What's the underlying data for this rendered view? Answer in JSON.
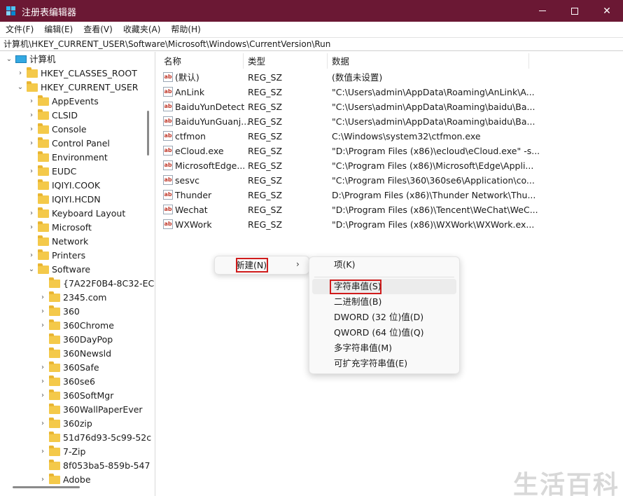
{
  "window": {
    "title": "注册表编辑器",
    "controls": {
      "minimize": "",
      "maximize": "",
      "close": "✕"
    }
  },
  "menu": [
    "文件(F)",
    "编辑(E)",
    "查看(V)",
    "收藏夹(A)",
    "帮助(H)"
  ],
  "address": "计算机\\HKEY_CURRENT_USER\\Software\\Microsoft\\Windows\\CurrentVersion\\Run",
  "tree": [
    {
      "label": "计算机",
      "chev": "⌄",
      "level": 0,
      "icon": "computer-icon"
    },
    {
      "label": "HKEY_CLASSES_ROOT",
      "chev": "›",
      "level": 1,
      "icon": "folder-icon"
    },
    {
      "label": "HKEY_CURRENT_USER",
      "chev": "⌄",
      "level": 1,
      "icon": "folder-icon"
    },
    {
      "label": "AppEvents",
      "chev": "›",
      "level": 2,
      "icon": "folder-icon"
    },
    {
      "label": "CLSID",
      "chev": "›",
      "level": 2,
      "icon": "folder-icon"
    },
    {
      "label": "Console",
      "chev": "›",
      "level": 2,
      "icon": "folder-icon"
    },
    {
      "label": "Control Panel",
      "chev": "›",
      "level": 2,
      "icon": "folder-icon"
    },
    {
      "label": "Environment",
      "chev": "",
      "level": 2,
      "icon": "folder-icon"
    },
    {
      "label": "EUDC",
      "chev": "›",
      "level": 2,
      "icon": "folder-icon"
    },
    {
      "label": "IQIYI.COOK",
      "chev": "",
      "level": 2,
      "icon": "folder-icon"
    },
    {
      "label": "IQIYI.HCDN",
      "chev": "",
      "level": 2,
      "icon": "folder-icon"
    },
    {
      "label": "Keyboard Layout",
      "chev": "›",
      "level": 2,
      "icon": "folder-icon"
    },
    {
      "label": "Microsoft",
      "chev": "›",
      "level": 2,
      "icon": "folder-icon"
    },
    {
      "label": "Network",
      "chev": "",
      "level": 2,
      "icon": "folder-icon"
    },
    {
      "label": "Printers",
      "chev": "›",
      "level": 2,
      "icon": "folder-icon"
    },
    {
      "label": "Software",
      "chev": "⌄",
      "level": 2,
      "icon": "folder-icon"
    },
    {
      "label": "{7A22F0B4-8C32-EC",
      "chev": "",
      "level": 3,
      "icon": "folder-icon"
    },
    {
      "label": "2345.com",
      "chev": "›",
      "level": 3,
      "icon": "folder-icon"
    },
    {
      "label": "360",
      "chev": "›",
      "level": 3,
      "icon": "folder-icon"
    },
    {
      "label": "360Chrome",
      "chev": "›",
      "level": 3,
      "icon": "folder-icon"
    },
    {
      "label": "360DayPop",
      "chev": "",
      "level": 3,
      "icon": "folder-icon"
    },
    {
      "label": "360Newsld",
      "chev": "",
      "level": 3,
      "icon": "folder-icon"
    },
    {
      "label": "360Safe",
      "chev": "›",
      "level": 3,
      "icon": "folder-icon"
    },
    {
      "label": "360se6",
      "chev": "›",
      "level": 3,
      "icon": "folder-icon"
    },
    {
      "label": "360SoftMgr",
      "chev": "›",
      "level": 3,
      "icon": "folder-icon"
    },
    {
      "label": "360WallPaperEver",
      "chev": "",
      "level": 3,
      "icon": "folder-icon"
    },
    {
      "label": "360zip",
      "chev": "›",
      "level": 3,
      "icon": "folder-icon"
    },
    {
      "label": "51d76d93-5c99-52c",
      "chev": "",
      "level": 3,
      "icon": "folder-icon"
    },
    {
      "label": "7-Zip",
      "chev": "›",
      "level": 3,
      "icon": "folder-icon"
    },
    {
      "label": "8f053ba5-859b-547",
      "chev": "",
      "level": 3,
      "icon": "folder-icon"
    },
    {
      "label": "Adobe",
      "chev": "›",
      "level": 3,
      "icon": "folder-icon"
    }
  ],
  "columns": [
    "名称",
    "类型",
    "数据"
  ],
  "values": [
    {
      "name": "(默认)",
      "type": "REG_SZ",
      "data": "(数值未设置)"
    },
    {
      "name": "AnLink",
      "type": "REG_SZ",
      "data": "\"C:\\Users\\admin\\AppData\\Roaming\\AnLink\\A..."
    },
    {
      "name": "BaiduYunDetect",
      "type": "REG_SZ",
      "data": "\"C:\\Users\\admin\\AppData\\Roaming\\baidu\\Ba..."
    },
    {
      "name": "BaiduYunGuanj...",
      "type": "REG_SZ",
      "data": "\"C:\\Users\\admin\\AppData\\Roaming\\baidu\\Ba..."
    },
    {
      "name": "ctfmon",
      "type": "REG_SZ",
      "data": "C:\\Windows\\system32\\ctfmon.exe"
    },
    {
      "name": "eCloud.exe",
      "type": "REG_SZ",
      "data": "\"D:\\Program Files (x86)\\ecloud\\eCloud.exe\" -s..."
    },
    {
      "name": "MicrosoftEdge...",
      "type": "REG_SZ",
      "data": "\"C:\\Program Files (x86)\\Microsoft\\Edge\\Appli..."
    },
    {
      "name": "sesvc",
      "type": "REG_SZ",
      "data": "\"C:\\Program Files\\360\\360se6\\Application\\co..."
    },
    {
      "name": "Thunder",
      "type": "REG_SZ",
      "data": "D:\\Program Files (x86)\\Thunder Network\\Thu..."
    },
    {
      "name": "Wechat",
      "type": "REG_SZ",
      "data": "\"D:\\Program Files (x86)\\Tencent\\WeChat\\WeC..."
    },
    {
      "name": "WXWork",
      "type": "REG_SZ",
      "data": "\"D:\\Program Files (x86)\\WXWork\\WXWork.ex..."
    }
  ],
  "context_menu": {
    "new_label": "新建(N)",
    "submenu_arrow": "›",
    "submenu": [
      "项(K)",
      "字符串值(S)",
      "二进制值(B)",
      "DWORD (32 位)值(D)",
      "QWORD (64 位)值(Q)",
      "多字符串值(M)",
      "可扩充字符串值(E)"
    ],
    "highlighted_index": 1,
    "highlight_color": "#d01c1c"
  },
  "watermark": "生活百科",
  "colors": {
    "titlebar": "#6b1834",
    "folder": "#f4c94a"
  }
}
